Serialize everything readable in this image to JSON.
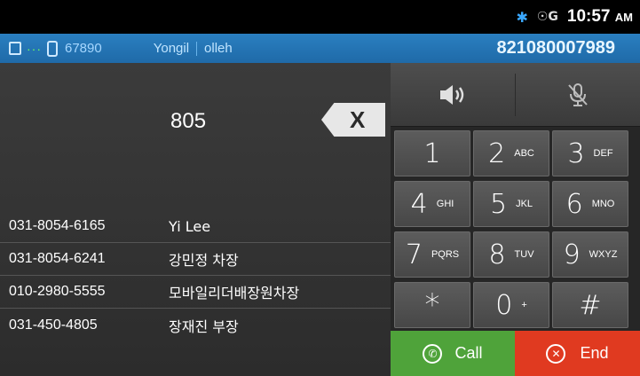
{
  "status_bar": {
    "time": "10:57",
    "ampm": "AM",
    "bluetooth_icon": "bluetooth-icon",
    "gps_icon": "gps-icon"
  },
  "call_info": {
    "extension": "67890",
    "name": "Yongil",
    "carrier": "olleh",
    "phone_number": "821080007989"
  },
  "dialer": {
    "input": "805"
  },
  "results": [
    {
      "number": "031-8054-6165",
      "name": "Yi Lee"
    },
    {
      "number": "031-8054-6241",
      "name": "강민정 차장"
    },
    {
      "number": "010-2980-5555",
      "name": "모바일리더배장원차장"
    },
    {
      "number": "031-450-4805",
      "name": "장재진 부장"
    }
  ],
  "keypad": [
    {
      "digit": "1",
      "letters": ""
    },
    {
      "digit": "2",
      "letters": "ABC"
    },
    {
      "digit": "3",
      "letters": "DEF"
    },
    {
      "digit": "4",
      "letters": "GHI"
    },
    {
      "digit": "5",
      "letters": "JKL"
    },
    {
      "digit": "6",
      "letters": "MNO"
    },
    {
      "digit": "7",
      "letters": "PQRS"
    },
    {
      "digit": "8",
      "letters": "TUV"
    },
    {
      "digit": "9",
      "letters": "WXYZ"
    },
    {
      "digit": "*",
      "letters": ""
    },
    {
      "digit": "0",
      "letters": "+"
    },
    {
      "digit": "#",
      "letters": ""
    }
  ],
  "actions": {
    "call_label": "Call",
    "end_label": "End"
  },
  "colors": {
    "call_green": "#4fa33a",
    "end_red": "#e03a20",
    "info_bar_blue": "#2a7fc0"
  }
}
